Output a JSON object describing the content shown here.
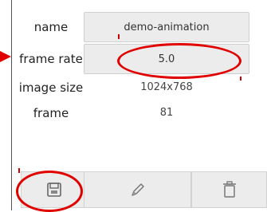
{
  "fields": [
    {
      "label": "name",
      "value": "demo-animation",
      "editable": true
    },
    {
      "label": "frame rate",
      "value": "5.0",
      "editable": true
    },
    {
      "label": "image size",
      "value": "1024x768",
      "editable": false
    },
    {
      "label": "frame",
      "value": "81",
      "editable": false
    }
  ],
  "toolbar": {
    "buttons": [
      {
        "icon": "save-icon"
      },
      {
        "icon": "pencil-icon"
      },
      {
        "icon": "trash-icon"
      }
    ]
  },
  "annotation_color": "#e00000"
}
